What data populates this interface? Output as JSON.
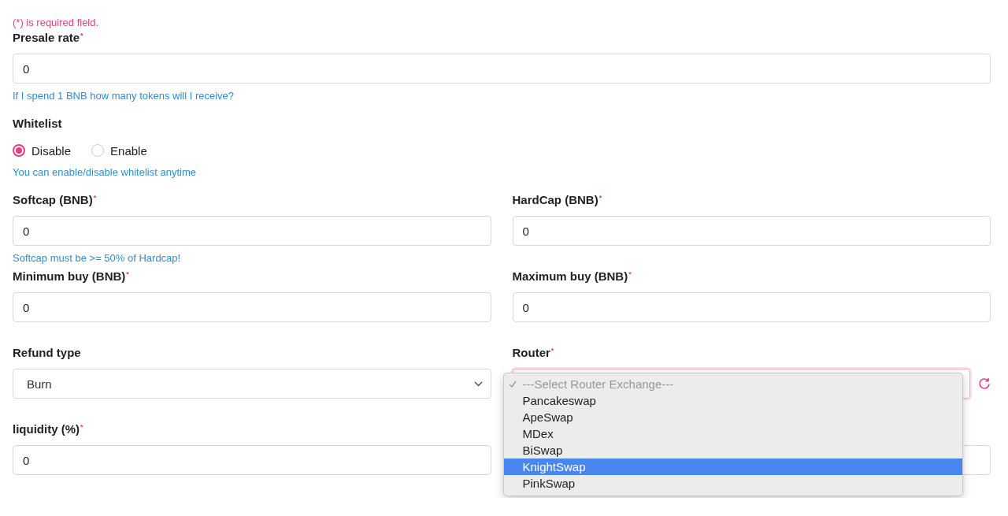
{
  "required_note": "(*) is required field.",
  "rows": [
    {
      "fields": [
        {
          "kind": "input",
          "label": "Presale rate$^{*}$",
          "value": "0",
          "hint": "If I spend 1 BNB how many tokens will I receive?"
        }
      ]
    },
    {
      "fields": [
        {
          "kind": "radio",
          "label": "Whitelist",
          "options": [
            {
              "label": "Disable",
              "selected": true
            },
            {
              "label": "Enable",
              "selected": false
            }
          ],
          "hint": "You can enable/disable whitelist anytime"
        }
      ]
    },
    {
      "fields": [
        {
          "kind": "input",
          "label": "Softcap (BNB)$^{*}$",
          "value": "0",
          "hint": "Softcap must be >= 50% of Hardcap!"
        },
        {
          "kind": "input",
          "label": "HardCap (BNB)$^{*}$",
          "value": "0"
        }
      ]
    },
    {
      "fields": [
        {
          "kind": "input",
          "label": "Minimum buy (BNB)$^{*}$",
          "value": "0"
        },
        {
          "kind": "input",
          "label": "Maximum buy (BNB)$^{*}$",
          "value": "0"
        }
      ]
    },
    {
      "fields": [
        {
          "kind": "select",
          "label": "Refund type",
          "value": "Burn",
          "invalid": false
        },
        {
          "kind": "select",
          "label": "Router$^{*}$",
          "invalid": true,
          "refresh": true,
          "menu": {
            "options": [
              {
                "label": "---Select Router Exchange---",
                "placeholder": true,
                "selected": true,
                "highlighted": false
              },
              {
                "label": "Pancakeswap",
                "placeholder": false,
                "selected": false,
                "highlighted": false
              },
              {
                "label": "ApeSwap",
                "placeholder": false,
                "selected": false,
                "highlighted": false
              },
              {
                "label": "MDex",
                "placeholder": false,
                "selected": false,
                "highlighted": false
              },
              {
                "label": "BiSwap",
                "placeholder": false,
                "selected": false,
                "highlighted": false
              },
              {
                "label": "KnightSwap",
                "placeholder": false,
                "selected": false,
                "highlighted": true
              },
              {
                "label": "PinkSwap",
                "placeholder": false,
                "selected": false,
                "highlighted": false
              }
            ]
          }
        }
      ]
    },
    {
      "fields": [
        {
          "kind": "input",
          "label": "liquidity (%)$^{*}$",
          "value": "0"
        },
        {
          "kind": "input"
        }
      ]
    }
  ]
}
